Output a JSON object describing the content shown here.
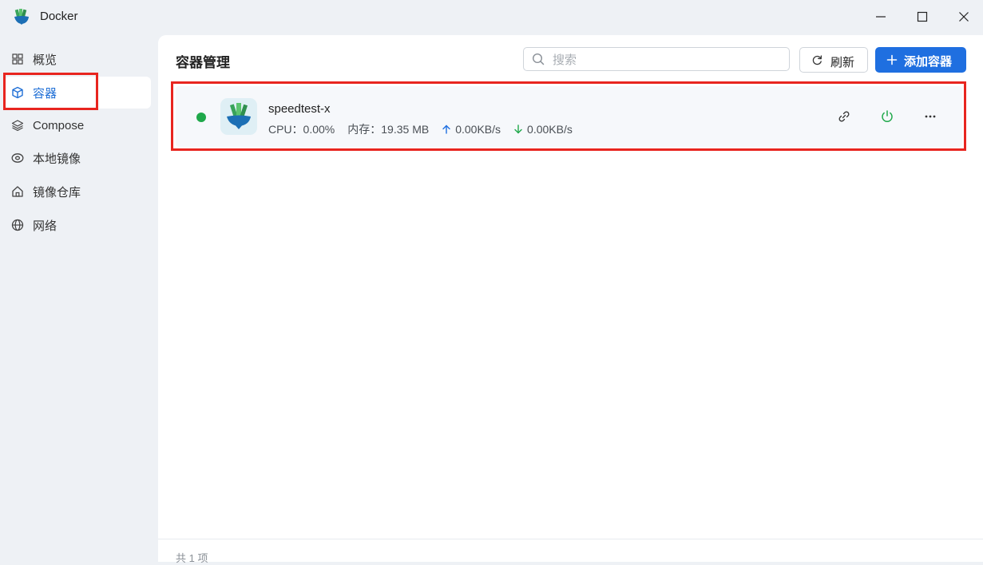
{
  "window": {
    "title": "Docker",
    "logo_icon": "docker-whale-icon"
  },
  "sidebar": {
    "items": [
      {
        "label": "概览",
        "icon": "grid-icon"
      },
      {
        "label": "容器",
        "icon": "cube-icon",
        "active": true
      },
      {
        "label": "Compose",
        "icon": "layers-icon"
      },
      {
        "label": "本地镜像",
        "icon": "disc-icon"
      },
      {
        "label": "镜像仓库",
        "icon": "home-icon"
      },
      {
        "label": "网络",
        "icon": "globe-icon"
      }
    ]
  },
  "main": {
    "title": "容器管理",
    "search": {
      "placeholder": "搜索",
      "value": ""
    },
    "refresh_label": "刷新",
    "add_label": "添加容器",
    "footer_count": "共 1 项"
  },
  "containers": [
    {
      "name": "speedtest-x",
      "status": "running",
      "cpu_text": "CPU：0.00%",
      "memory_text": "内存：19.35 MB",
      "upload_text": "0.00KB/s",
      "download_text": "0.00KB/s"
    }
  ],
  "colors": {
    "accent": "#1f6fe0",
    "running": "#1fa84a",
    "highlight": "#e8251f",
    "sidebar_bg": "#eef1f5"
  }
}
